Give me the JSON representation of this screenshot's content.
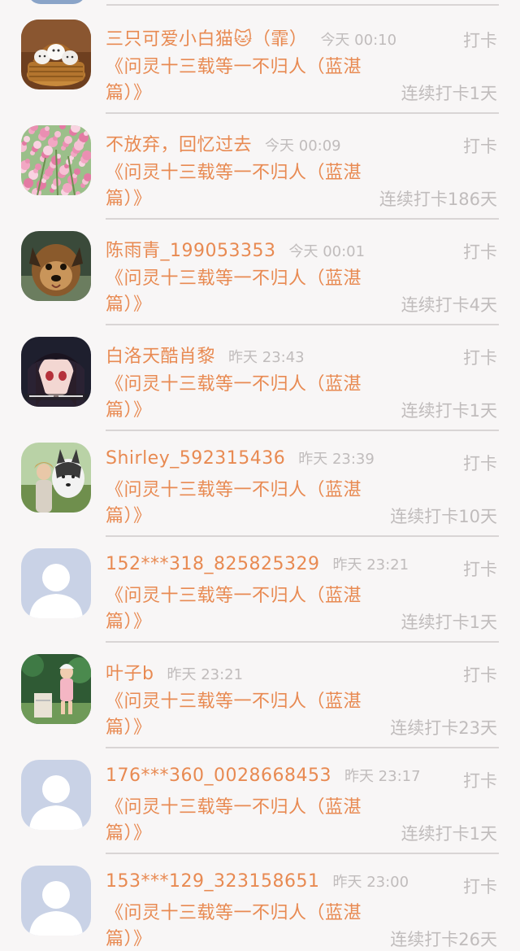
{
  "checkin_label": "打卡",
  "items": [
    {
      "name": "三只可爱小白猫🐱（霏）",
      "time": "今天 00:10",
      "book": "《问灵十三载等一不归人（蓝湛篇）》",
      "streak": "连续打卡1天",
      "avatar": "cats-in-basket"
    },
    {
      "name": "不放弃，回忆过去",
      "time": "今天 00:09",
      "book": "《问灵十三载等一不归人（蓝湛篇）》",
      "streak": "连续打卡186天",
      "avatar": "pink-flowers"
    },
    {
      "name": "陈雨青_199053353",
      "time": "今天 00:01",
      "book": "《问灵十三载等一不归人（蓝湛篇）》",
      "streak": "连续打卡4天",
      "avatar": "yorkie-dog"
    },
    {
      "name": "白洛天酷肖黎",
      "time": "昨天 23:43",
      "book": "《问灵十三载等一不归人（蓝湛篇）》",
      "streak": "连续打卡1天",
      "avatar": "anime-character"
    },
    {
      "name": "Shirley_592315436",
      "time": "昨天 23:39",
      "book": "《问灵十三载等一不归人（蓝湛篇）》",
      "streak": "连续打卡10天",
      "avatar": "husky-and-person"
    },
    {
      "name": "152***318_825825329",
      "time": "昨天 23:21",
      "book": "《问灵十三载等一不归人（蓝湛篇）》",
      "streak": "连续打卡1天",
      "avatar": "default-user"
    },
    {
      "name": "叶子b",
      "time": "昨天 23:21",
      "book": "《问灵十三载等一不归人（蓝湛篇）》",
      "streak": "连续打卡23天",
      "avatar": "girl-in-garden"
    },
    {
      "name": "176***360_0028668453",
      "time": "昨天 23:17",
      "book": "《问灵十三载等一不归人（蓝湛篇）》",
      "streak": "连续打卡1天",
      "avatar": "default-user"
    },
    {
      "name": "153***129_323158651",
      "time": "昨天 23:00",
      "book": "《问灵十三载等一不归人（蓝湛篇）》",
      "streak": "连续打卡26天",
      "avatar": "default-user"
    }
  ]
}
